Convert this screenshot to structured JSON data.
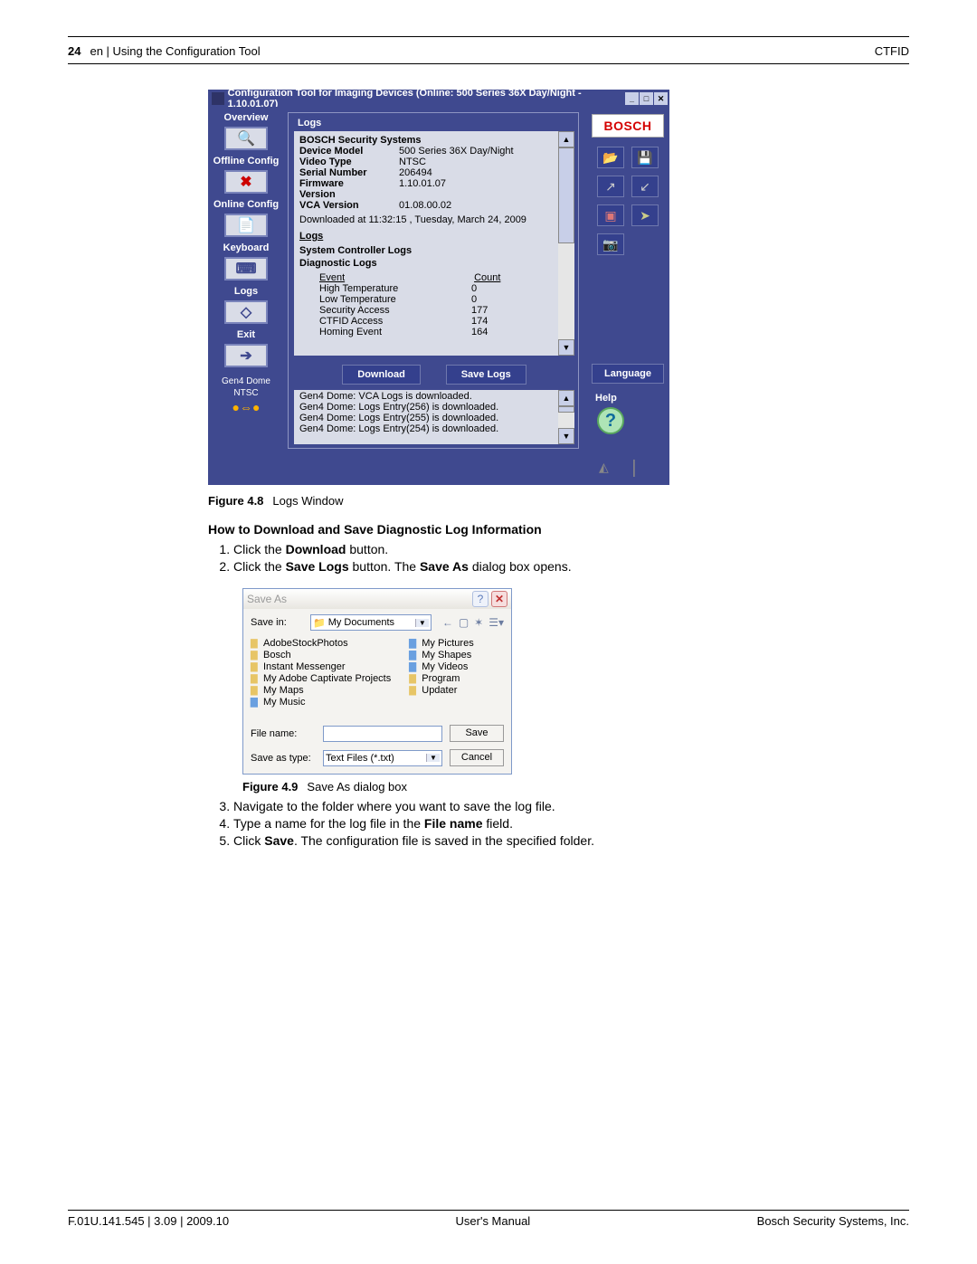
{
  "header": {
    "page_number": "24",
    "breadcrumb": "en | Using the Configuration Tool",
    "product": "CTFID"
  },
  "cfg_window": {
    "title": "Configuration Tool for Imaging Devices (Online: 500 Series 36X Day/Night - 1.10.01.07)",
    "sidebar": {
      "overview": "Overview",
      "offline": "Offline Config",
      "online": "Online Config",
      "keyboard": "Keyboard",
      "logs": "Logs",
      "exit": "Exit",
      "device_model": "Gen4 Dome",
      "device_std": "NTSC"
    },
    "logs_panel_title": "Logs",
    "info": {
      "company": "BOSCH Security Systems",
      "rows": [
        {
          "k": "Device Model",
          "v": "500 Series 36X Day/Night"
        },
        {
          "k": "Video Type",
          "v": "NTSC"
        },
        {
          "k": "Serial Number",
          "v": "206494"
        },
        {
          "k": "Firmware",
          "v": "1.10.01.07"
        },
        {
          "k": "Version",
          "v": ""
        },
        {
          "k": "VCA Version",
          "v": "01.08.00.02"
        }
      ],
      "downloaded": "Downloaded at 11:32:15 , Tuesday, March 24, 2009",
      "logs_h": "Logs",
      "sys_h": "System Controller Logs",
      "diag_h": "Diagnostic Logs",
      "event_h": "Event",
      "count_h": "Count",
      "events": [
        {
          "ev": "High Temperature",
          "c": "0"
        },
        {
          "ev": "Low Temperature",
          "c": "0"
        },
        {
          "ev": "Security Access",
          "c": "177"
        },
        {
          "ev": "CTFID Access",
          "c": "174"
        },
        {
          "ev": "Homing Event",
          "c": "164"
        }
      ]
    },
    "buttons": {
      "download": "Download",
      "save_logs": "Save Logs"
    },
    "status": [
      "Gen4 Dome: VCA Logs is downloaded.",
      "Gen4 Dome: Logs Entry(256) is downloaded.",
      "Gen4 Dome: Logs Entry(255) is downloaded.",
      "Gen4 Dome: Logs Entry(254) is downloaded."
    ],
    "right": {
      "brand": "BOSCH",
      "language": "Language",
      "help": "Help"
    }
  },
  "fig48": {
    "label": "Figure 4.8",
    "caption": "Logs Window"
  },
  "section_title": "How to Download and Save Diagnostic Log Information",
  "step1a": "Click the ",
  "step1b": "Download",
  "step1c": " button.",
  "step2a": "Click the ",
  "step2b": "Save Logs",
  "step2c": " button. The ",
  "step2d": "Save As",
  "step2e": " dialog box opens.",
  "saveas": {
    "title": "Save As",
    "save_in_lbl": "Save in:",
    "save_in_val": "My Documents",
    "col1": [
      "AdobeStockPhotos",
      "Bosch",
      "Instant Messenger",
      "My Adobe Captivate Projects",
      "My Maps",
      "My Music"
    ],
    "col2": [
      "My Pictures",
      "My Shapes",
      "My Videos",
      "Program",
      "Updater"
    ],
    "filename_lbl": "File name:",
    "filetype_lbl": "Save as type:",
    "filetype_val": "Text Files (*.txt)",
    "save_btn": "Save",
    "cancel_btn": "Cancel"
  },
  "fig49": {
    "label": "Figure 4.9",
    "caption": "Save As dialog box"
  },
  "step3": "Navigate to the folder where you want to save the log file.",
  "step4a": "Type a name for the log file in the ",
  "step4b": "File name",
  "step4c": " field.",
  "step5a": "Click ",
  "step5b": "Save",
  "step5c": ". The configuration file is saved in the specified folder.",
  "footer": {
    "left": "F.01U.141.545 | 3.09 | 2009.10",
    "center": "User's Manual",
    "right": "Bosch Security Systems, Inc."
  }
}
